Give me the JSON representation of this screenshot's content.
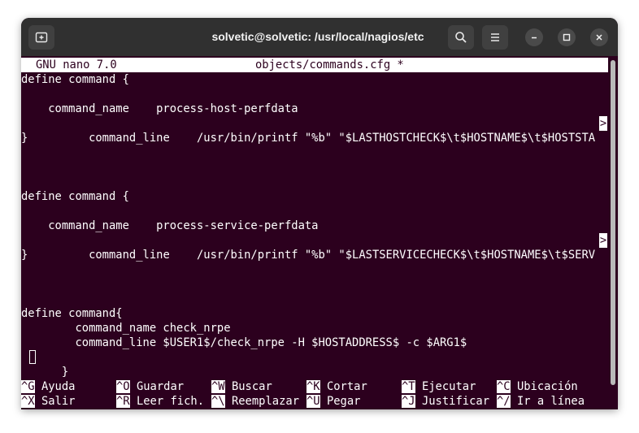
{
  "window": {
    "title": "solvetic@solvetic: /usr/local/nagios/etc"
  },
  "icons": {
    "new_tab": "new-tab-icon",
    "search": "search-icon",
    "menu": "hamburger-menu-icon",
    "minimize": "minimize-icon",
    "maximize": "maximize-icon",
    "close": "close-icon"
  },
  "nano": {
    "version": "GNU nano 7.0",
    "filename": "objects/commands.cfg *",
    "lines": [
      "define command {",
      "",
      "    command_name    process-host-perfdata",
      "    command_line    /usr/bin/printf \"%b\" \"$LASTHOSTCHECK$\\t$HOSTNAME$\\t$HOSTSTA",
      "}",
      "",
      "",
      "",
      "define command {",
      "",
      "    command_name    process-service-perfdata",
      "    command_line    /usr/bin/printf \"%b\" \"$LASTSERVICECHECK$\\t$HOSTNAME$\\t$SERV",
      "}",
      "",
      "",
      "",
      "define command{",
      "        command_name check_nrpe",
      "        command_line $USER1$/check_nrpe -H $HOSTADDRESS$ -c $ARG1$",
      "}"
    ],
    "truncation_marker": ">",
    "shortcuts_row1": [
      {
        "key": "^G",
        "label": "Ayuda"
      },
      {
        "key": "^O",
        "label": "Guardar"
      },
      {
        "key": "^W",
        "label": "Buscar"
      },
      {
        "key": "^K",
        "label": "Cortar"
      },
      {
        "key": "^T",
        "label": "Ejecutar"
      },
      {
        "key": "^C",
        "label": "Ubicación"
      }
    ],
    "shortcuts_row2": [
      {
        "key": "^X",
        "label": "Salir"
      },
      {
        "key": "^R",
        "label": "Leer fich."
      },
      {
        "key": "^\\",
        "label": "Reemplazar"
      },
      {
        "key": "^U",
        "label": "Pegar"
      },
      {
        "key": "^J",
        "label": "Justificar"
      },
      {
        "key": "^/",
        "label": "Ir a línea"
      }
    ]
  },
  "colors": {
    "terminal_bg": "#2c001e",
    "titlebar_bg": "#303030",
    "text": "#ffffff"
  }
}
